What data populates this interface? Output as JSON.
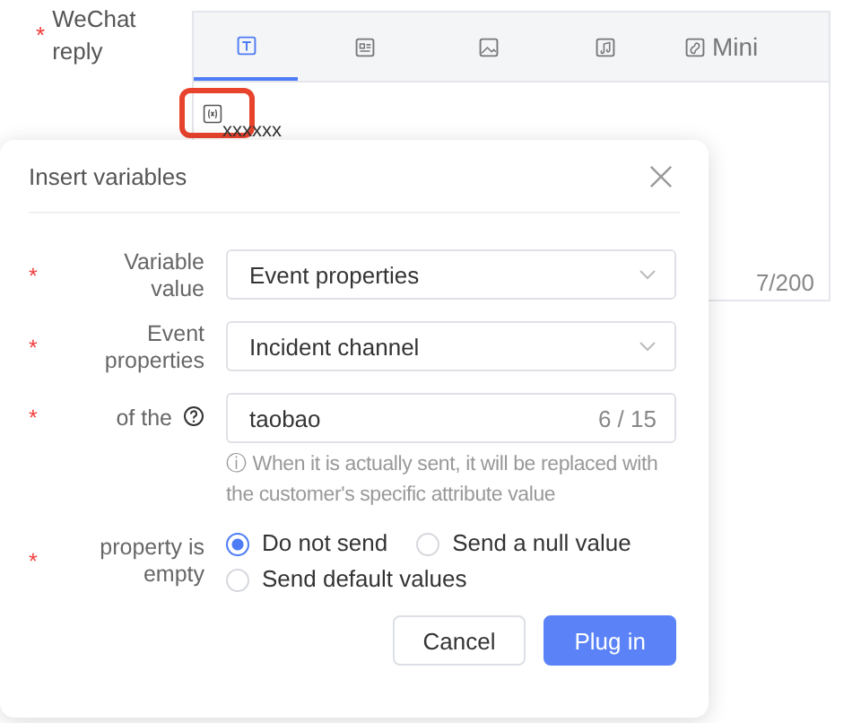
{
  "form": {
    "label": "WeChat reply",
    "required_mark": "*"
  },
  "editor": {
    "tabs": [
      {
        "kind": "text",
        "selected": true
      },
      {
        "kind": "card",
        "selected": false
      },
      {
        "kind": "image",
        "selected": false
      },
      {
        "kind": "audio",
        "selected": false
      },
      {
        "kind": "mini",
        "label": "Mini",
        "selected": false
      }
    ],
    "content": "xxxxxx",
    "count": "7/200"
  },
  "dialog": {
    "title": "Insert variables",
    "fields": [
      {
        "kind": "select",
        "label": "Variable value",
        "required_mark": "*",
        "value": "Event properties"
      },
      {
        "kind": "select",
        "label": "Event properties",
        "required_mark": "*",
        "value": "Incident channel"
      },
      {
        "kind": "input",
        "label": "of the",
        "required_mark": "*",
        "help": true,
        "value": "taobao",
        "count": "6 / 15",
        "hint": "ⓘ When it is actually sent, it will be replaced with the customer's specific attribute value"
      },
      {
        "kind": "radio",
        "label": "property is empty",
        "required_mark": "*",
        "options": [
          {
            "label": "Do not send",
            "selected": true
          },
          {
            "label": "Send a null value",
            "selected": false
          },
          {
            "label": "Send default values",
            "selected": false
          }
        ]
      }
    ],
    "buttons": [
      {
        "kind": "secondary",
        "label": "Cancel"
      },
      {
        "kind": "primary",
        "label": "Plug in"
      }
    ]
  }
}
